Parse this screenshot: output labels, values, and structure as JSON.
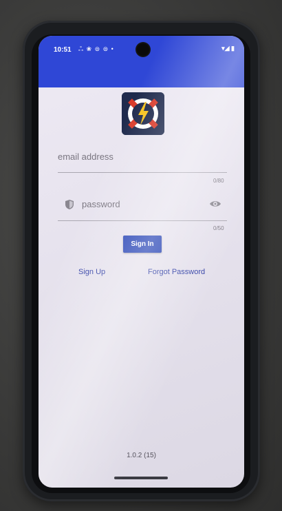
{
  "status": {
    "time": "10:51",
    "notification_icons": "ஃ ❀ ⊜ ⊜ •",
    "system_icons": "▾◢ ▮"
  },
  "login": {
    "email_placeholder": "email address",
    "email_counter": "0/80",
    "password_placeholder": "password",
    "password_counter": "0/50",
    "sign_in_label": "Sign In",
    "sign_up_label": "Sign Up",
    "forgot_password_label": "Forgot Password"
  },
  "footer": {
    "version": "1.0.2 (15)"
  },
  "colors": {
    "app_bar": "#2f47d6",
    "button": "#1d3bb2",
    "link": "#2b3aa3"
  },
  "icons": [
    "app-logo-icon",
    "shield-icon",
    "eye-icon",
    "camera-hole"
  ]
}
